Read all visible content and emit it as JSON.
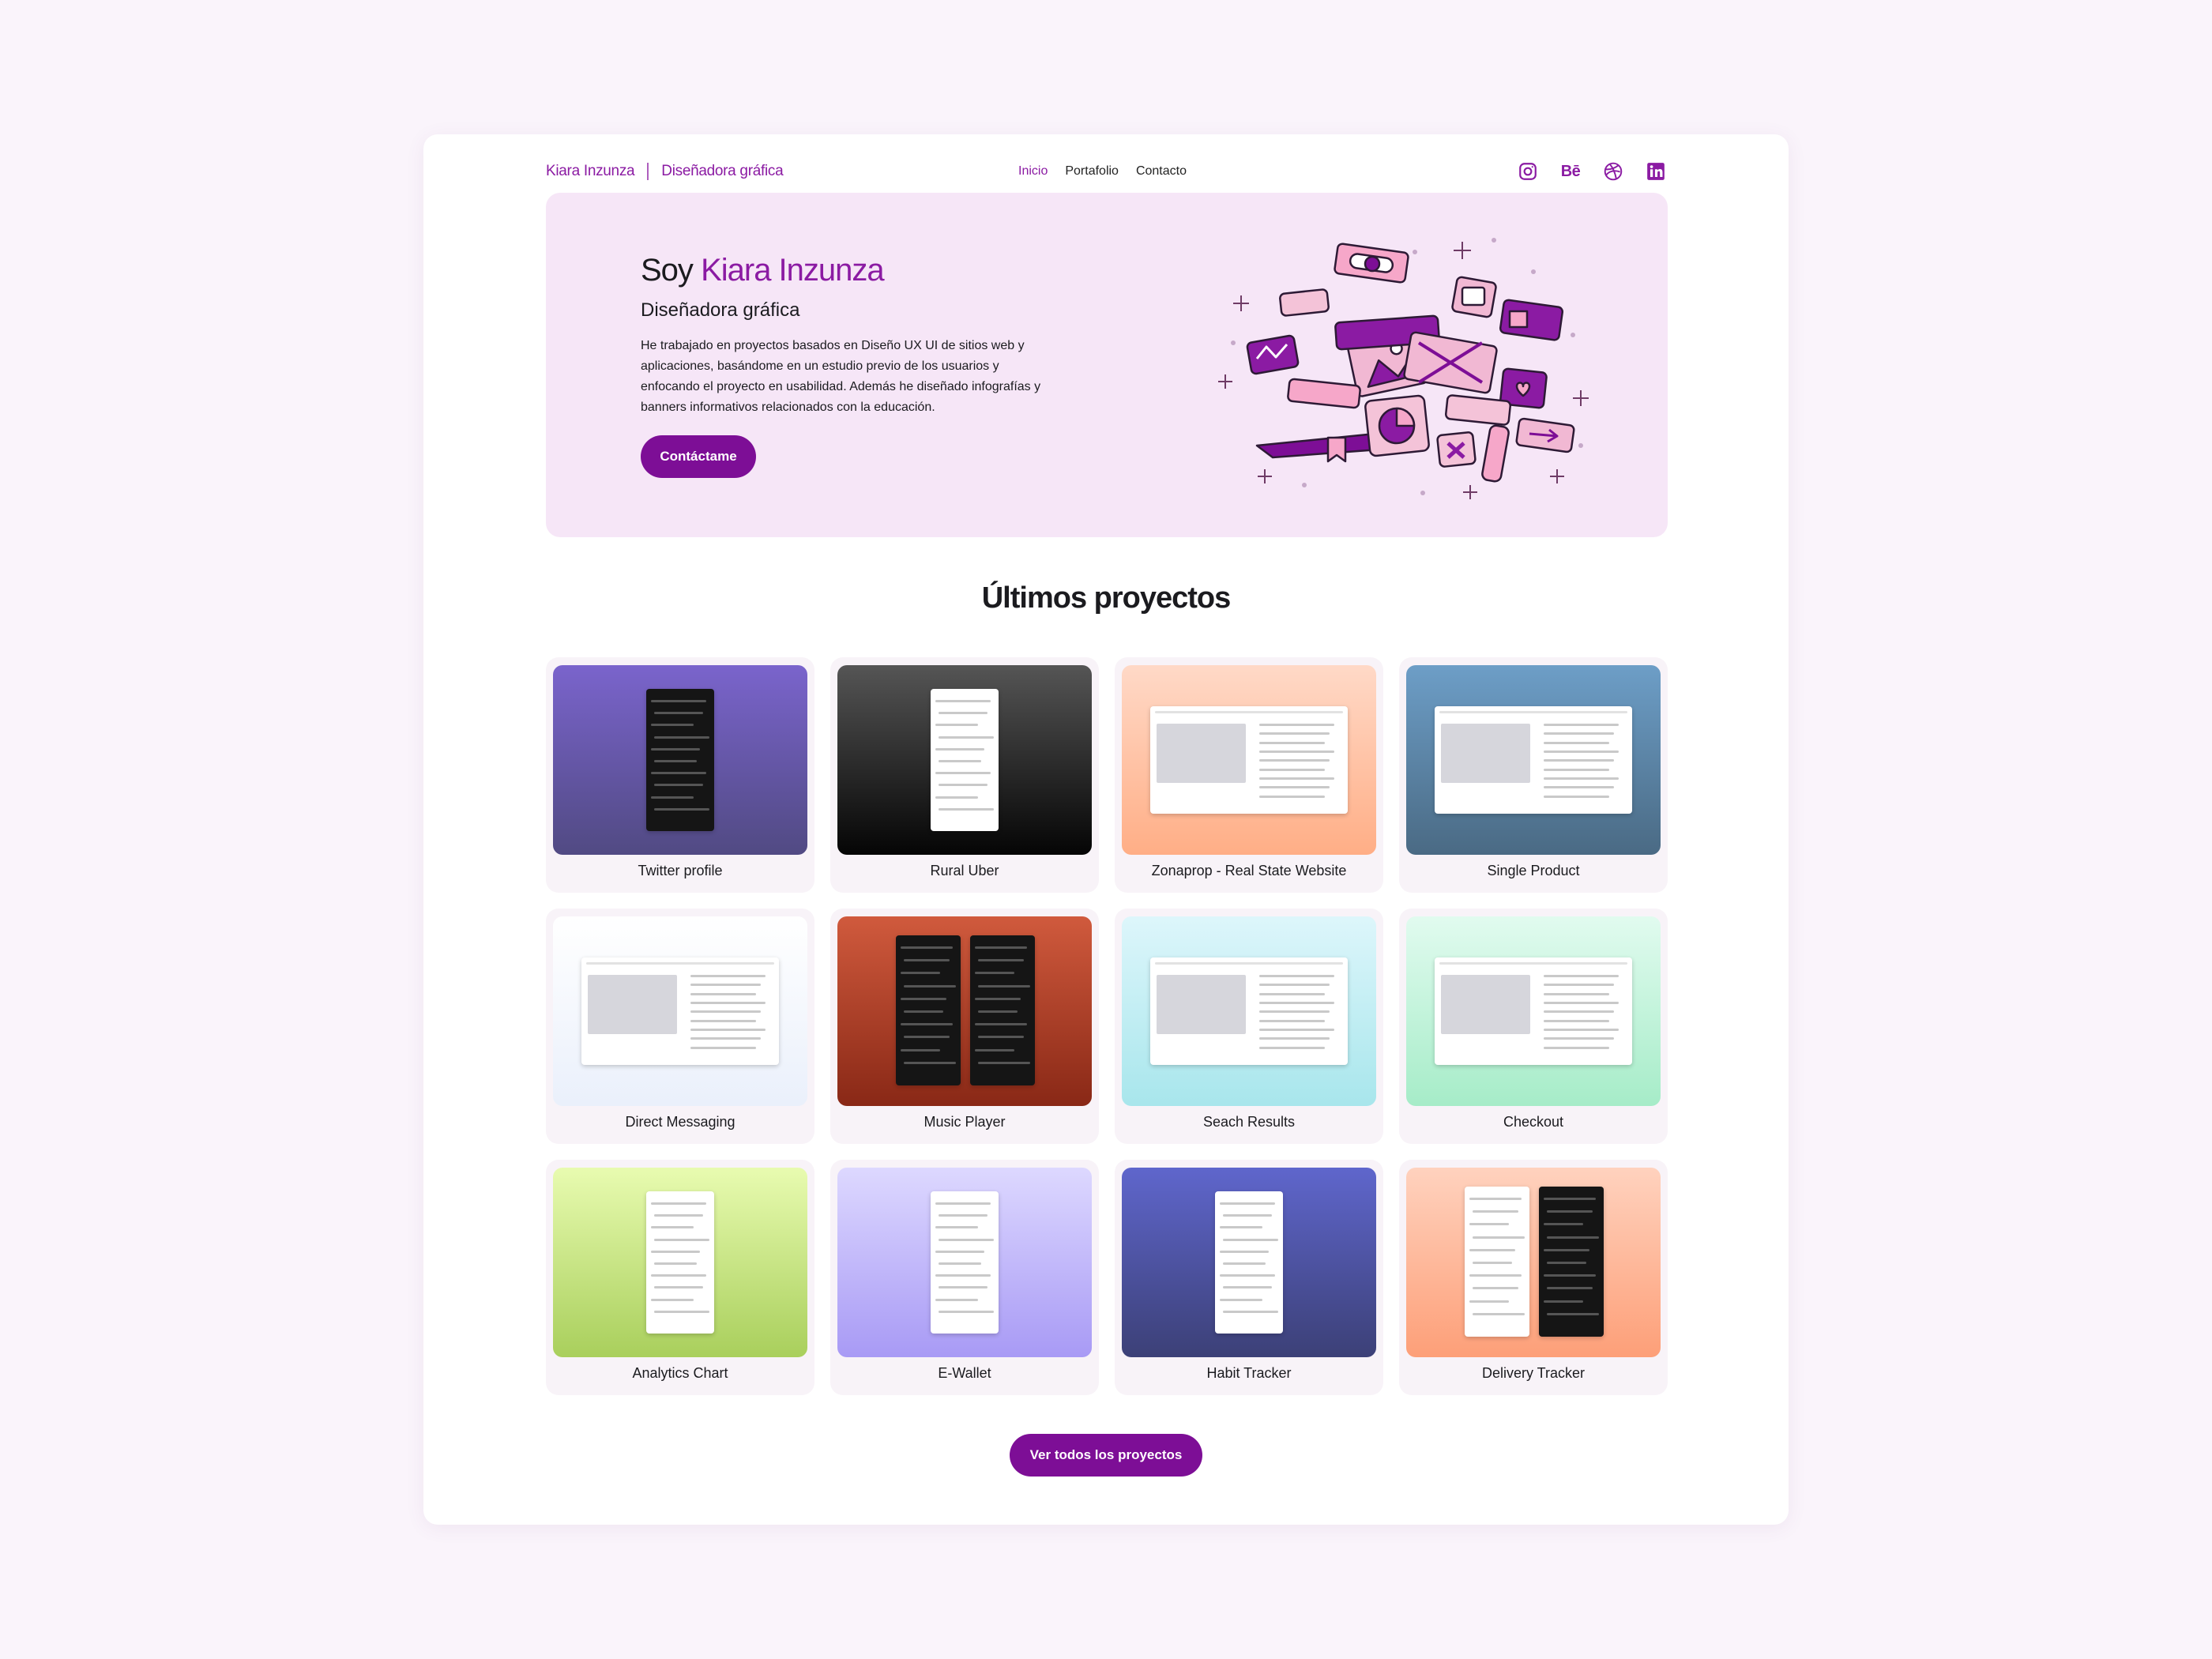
{
  "header": {
    "name": "Kiara Inzunza",
    "role": "Diseñadora gráfica",
    "nav": [
      {
        "label": "Inicio",
        "active": true
      },
      {
        "label": "Portafolio",
        "active": false
      },
      {
        "label": "Contacto",
        "active": false
      }
    ],
    "socials": [
      {
        "icon": "instagram-icon"
      },
      {
        "icon": "behance-icon",
        "text": "Bē"
      },
      {
        "icon": "dribbble-icon"
      },
      {
        "icon": "linkedin-icon"
      }
    ]
  },
  "hero": {
    "title_prefix": "Soy",
    "title_name": "Kiara Inzunza",
    "subtitle": "Diseñadora gráfica",
    "description": "He trabajado en proyectos basados en Diseño UX UI de sitios web y aplicaciones, basándome en un estudio previo de los usuarios y enfocando el proyecto en usabilidad. Además he diseñado infografías y banners informativos relacionados con la educación.",
    "cta": "Contáctame"
  },
  "projects_section": {
    "title": "Últimos proyectos",
    "cta": "Ver todos los proyectos",
    "projects": [
      {
        "label": "Twitter profile",
        "bg": [
          "#7a64cc",
          "#514a83"
        ],
        "mock": "phone-dark"
      },
      {
        "label": "Rural Uber",
        "bg": [
          "#555555",
          "#050505"
        ],
        "mock": "phone-light"
      },
      {
        "label": "Zonaprop - Real State Website",
        "bg": [
          "#ffd9c7",
          "#ffae86"
        ],
        "mock": "web"
      },
      {
        "label": "Single Product",
        "bg": [
          "#6d9ec7",
          "#4a6a84"
        ],
        "mock": "web"
      },
      {
        "label": "Direct Messaging",
        "bg": [
          "#ffffff",
          "#eaf0fb"
        ],
        "mock": "web"
      },
      {
        "label": "Music Player",
        "bg": [
          "#d05a3d",
          "#892816"
        ],
        "mock": "two-phones-dark"
      },
      {
        "label": "Seach Results",
        "bg": [
          "#ddf6fb",
          "#a8e6ec"
        ],
        "mock": "web"
      },
      {
        "label": "Checkout",
        "bg": [
          "#e1fbef",
          "#a6ecc8"
        ],
        "mock": "web"
      },
      {
        "label": "Analytics Chart",
        "bg": [
          "#e8fbb0",
          "#a9cf5c"
        ],
        "mock": "phone-light"
      },
      {
        "label": "E-Wallet",
        "bg": [
          "#ddd8ff",
          "#a89af5"
        ],
        "mock": "phone-light"
      },
      {
        "label": "Habit Tracker",
        "bg": [
          "#5f66cc",
          "#3c4077"
        ],
        "mock": "phone-light"
      },
      {
        "label": "Delivery Tracker",
        "bg": [
          "#ffd2be",
          "#fd9f78"
        ],
        "mock": "two-phones-mixed"
      }
    ]
  },
  "colors": {
    "accent": "#8b1ba3",
    "button": "#7d0e96",
    "hero_bg": "#f6e6f7",
    "page_bg": "#faf4fb"
  }
}
